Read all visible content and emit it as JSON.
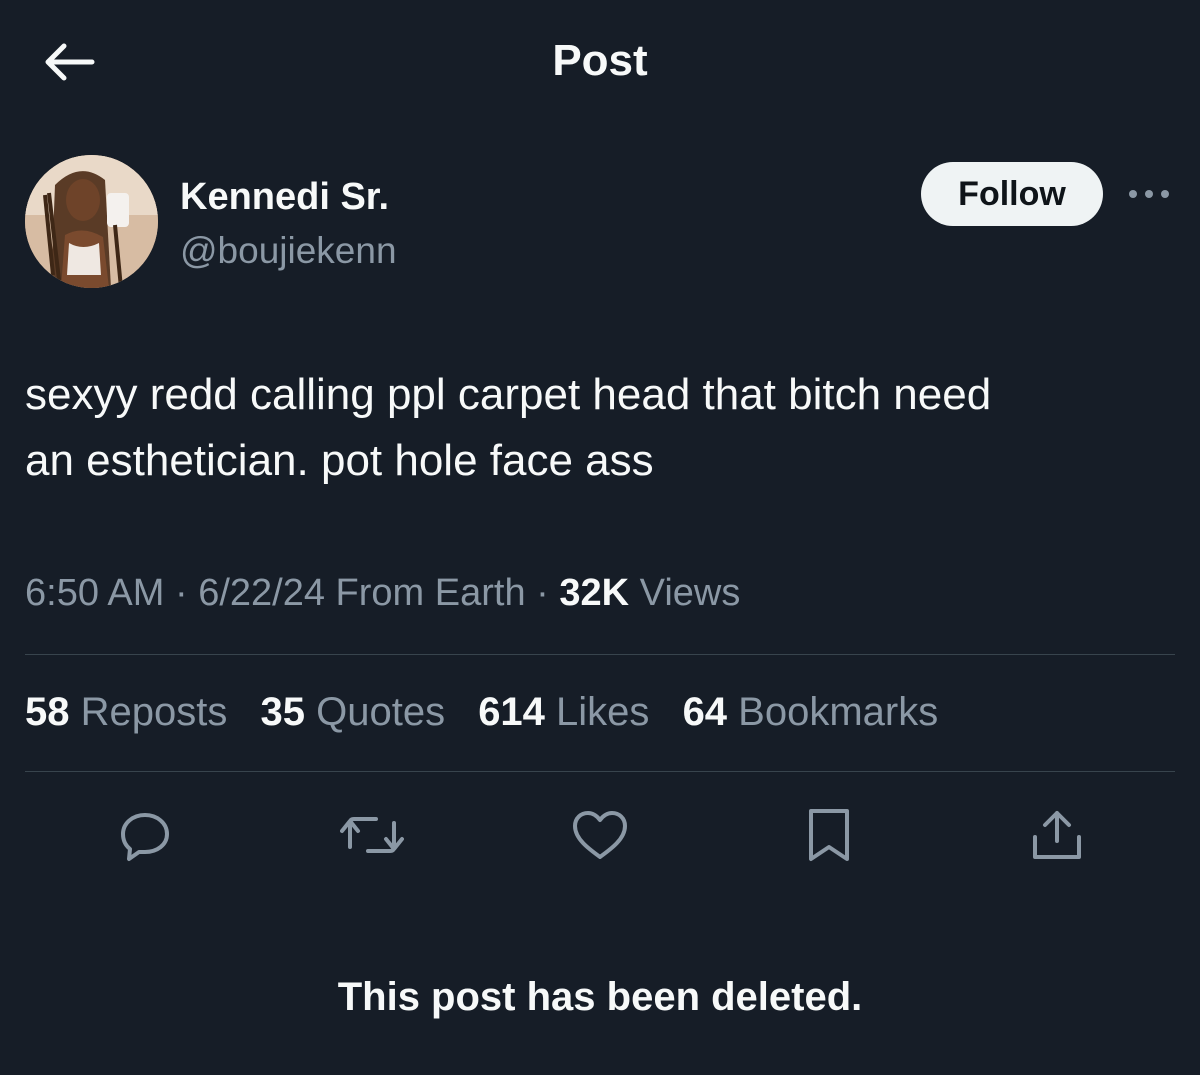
{
  "header": {
    "title": "Post",
    "back_icon": "arrow-left-icon"
  },
  "author": {
    "display_name": "Kennedi Sr.",
    "handle": "@boujiekenn",
    "follow_label": "Follow",
    "more_icon": "more-horizontal-icon"
  },
  "tweet": {
    "line1": "sexyy redd calling ppl carpet head that bitch need",
    "line2": "an esthetician. pot hole face ass"
  },
  "meta": {
    "time": "6:50 AM",
    "sep1": " · ",
    "date": "6/22/24",
    "location": " From Earth",
    "sep2": " · ",
    "views_count": "32K",
    "views_label": " Views"
  },
  "stats": [
    {
      "count": "58",
      "label": " Reposts"
    },
    {
      "count": "35",
      "label": " Quotes"
    },
    {
      "count": "614",
      "label": " Likes"
    },
    {
      "count": "64",
      "label": " Bookmarks"
    }
  ],
  "actions": [
    {
      "icon": "reply-icon"
    },
    {
      "icon": "repost-icon"
    },
    {
      "icon": "like-icon"
    },
    {
      "icon": "bookmark-icon"
    },
    {
      "icon": "share-icon"
    }
  ],
  "notice": "This post has been deleted.",
  "colors": {
    "background": "#161d27",
    "text_primary": "#f7f9f9",
    "text_secondary": "#8b98a5",
    "divider": "#38444d",
    "follow_bg": "#eff3f4"
  }
}
